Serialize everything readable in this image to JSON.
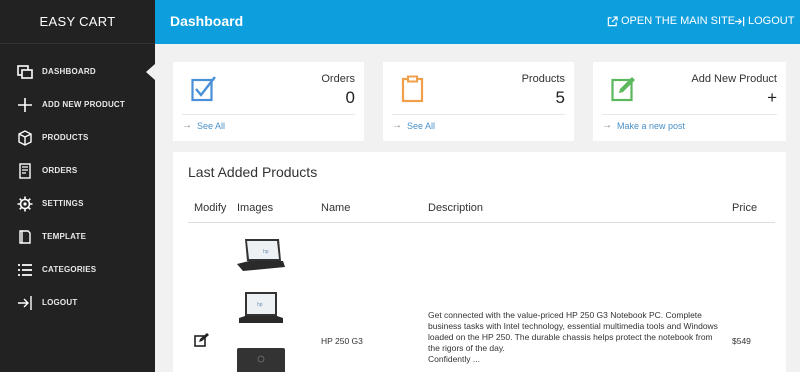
{
  "brand": "EASY CART",
  "sidebar": {
    "items": [
      {
        "label": "DASHBOARD",
        "icon": "dashboard-icon"
      },
      {
        "label": "ADD NEW PRODUCT",
        "icon": "plus-icon"
      },
      {
        "label": "PRODUCTS",
        "icon": "box-icon"
      },
      {
        "label": "ORDERS",
        "icon": "receipt-icon"
      },
      {
        "label": "SETTINGS",
        "icon": "gear-icon"
      },
      {
        "label": "TEMPLATE",
        "icon": "book-icon"
      },
      {
        "label": "CATEGORIES",
        "icon": "list-icon"
      },
      {
        "label": "LOGOUT",
        "icon": "logout-icon"
      }
    ]
  },
  "header": {
    "title": "Dashboard",
    "open_site": "OPEN THE MAIN SITE",
    "logout": "LOGOUT"
  },
  "cards": [
    {
      "title": "Orders",
      "value": "0",
      "link": "See All",
      "icon": "checkbox-icon",
      "color": "#4a90d9"
    },
    {
      "title": "Products",
      "value": "5",
      "link": "See All",
      "icon": "clipboard-icon",
      "color": "#f0a04b"
    },
    {
      "title": "Add New Product",
      "value": "+",
      "link": "Make a new post",
      "icon": "edit-square-icon",
      "color": "#5cb85c"
    }
  ],
  "panel": {
    "title": "Last Added Products",
    "columns": [
      "Modify",
      "Images",
      "Name",
      "Description",
      "Price"
    ],
    "rows": [
      {
        "name": "HP 250 G3",
        "description": "Get connected with the value-priced HP 250 G3 Notebook PC. Complete business tasks with Intel technology, essential multimedia tools and Windows loaded on the HP 250. The durable chassis helps protect the notebook from the rigors of the day.",
        "description_more": "Confidently ...",
        "price": "$549"
      }
    ]
  },
  "colors": {
    "header": "#0d9ede",
    "sidebar": "#222222"
  }
}
